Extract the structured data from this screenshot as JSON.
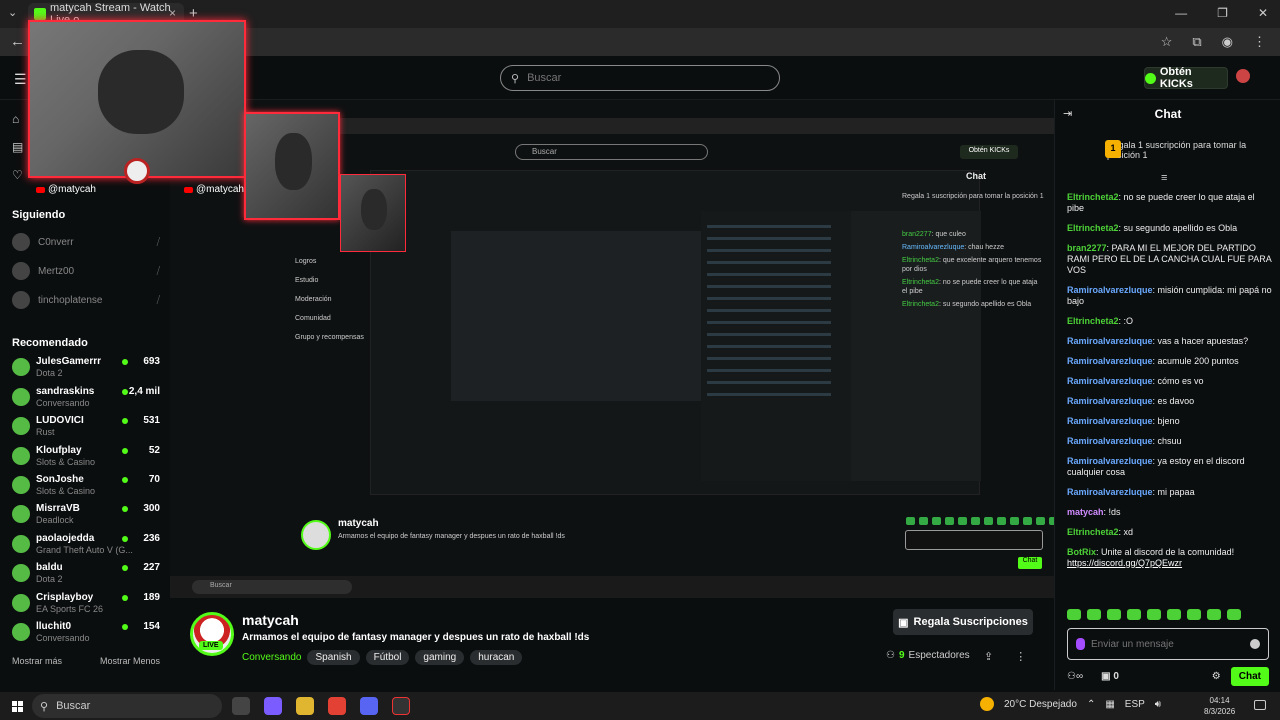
{
  "browser": {
    "tab_title": "matycah Stream - Watch Live o",
    "tab_close": "×",
    "new_tab": "+"
  },
  "header": {
    "search_placeholder": "Buscar",
    "kicks_label": "Obtén KICKs"
  },
  "webcam": {
    "handle": "@matycah"
  },
  "sidebar": {
    "following_title": "Siguiendo",
    "following": [
      {
        "name": "C0nverr"
      },
      {
        "name": "Mertz00"
      },
      {
        "name": "tinchoplatense"
      }
    ],
    "recommended_title": "Recomendado",
    "recommended": [
      {
        "name": "JulesGamerrr",
        "category": "Dota 2",
        "viewers": "693"
      },
      {
        "name": "sandraskins",
        "category": "Conversando",
        "viewers": "2,4 mil"
      },
      {
        "name": "LUDOVICI",
        "category": "Rust",
        "viewers": "531"
      },
      {
        "name": "Kloufplay",
        "category": "Slots & Casino",
        "viewers": "52"
      },
      {
        "name": "SonJoshe",
        "category": "Slots & Casino",
        "viewers": "70"
      },
      {
        "name": "MisrraVB",
        "category": "Deadlock",
        "viewers": "300"
      },
      {
        "name": "paolaojedda",
        "category": "Grand Theft Auto V (G...",
        "viewers": "236"
      },
      {
        "name": "baldu",
        "category": "Dota 2",
        "viewers": "227"
      },
      {
        "name": "Crisplayboy",
        "category": "EA Sports FC 26",
        "viewers": "189"
      },
      {
        "name": "lluchit0",
        "category": "Conversando",
        "viewers": "154"
      }
    ],
    "show_more": "Mostrar más",
    "show_less": "Mostrar Menos"
  },
  "stream_preview": {
    "search": "Buscar",
    "kicks": "Obtén KICKs",
    "chat_title": "Chat",
    "gift": "Regala 1 suscripción para tomar la posición 1",
    "nav": [
      "Logros",
      "Estudio",
      "Moderación",
      "Comunidad",
      "Grupo y recompensas"
    ],
    "messages": [
      {
        "user": "bran2277",
        "text": "que culeo"
      },
      {
        "user": "Ramiroalvarezluque",
        "text": "chau hezze"
      },
      {
        "user": "Eltrincheta2",
        "text": "que excelente arquero tenemos por dios"
      },
      {
        "user": "Eltrincheta2",
        "text": "no se puede creer lo que ataja el pibe"
      },
      {
        "user": "Eltrincheta2",
        "text": "su segundo apellido es Obla"
      }
    ],
    "info_title": "Armamos el equipo de fantasy manager y despues un rato de haxball !ds",
    "search_taskbar": "Buscar"
  },
  "channel": {
    "name": "matycah",
    "live": "LIVE",
    "title": "Armamos el equipo de fantasy manager y despues un rato de haxball !ds",
    "category": "Conversando",
    "tags": [
      "Spanish",
      "Fútbol",
      "gaming",
      "huracan"
    ],
    "subs_button": "Regala Suscripciones",
    "viewers_count": "9",
    "viewers_label": "Espectadores"
  },
  "chat": {
    "title": "Chat",
    "gift_badge": "1",
    "gift_text": "Regala 1 suscripción para tomar la posición 1",
    "messages": [
      {
        "user": "Eltrincheta2",
        "text": "no se puede creer lo que ataja el pibe",
        "color": "#4cd137"
      },
      {
        "user": "Eltrincheta2",
        "text": "su segundo apellido es Obla",
        "color": "#4cd137"
      },
      {
        "user": "bran2277",
        "text": "PARA MI EL MEJOR DEL PARTIDO RAMI PERO EL DE LA CANCHA CUAL FUE PARA VOS",
        "color": "#4cd137"
      },
      {
        "user": "Ramiroalvarezluque",
        "text": "misión cumplida: mi papá no bajo",
        "color": "#6aa9ff"
      },
      {
        "user": "Eltrincheta2",
        "text": ":O",
        "color": "#4cd137"
      },
      {
        "user": "Ramiroalvarezluque",
        "text": "vas a hacer apuestas?",
        "color": "#6aa9ff"
      },
      {
        "user": "Ramiroalvarezluque",
        "text": "acumule 200 puntos",
        "color": "#6aa9ff"
      },
      {
        "user": "Ramiroalvarezluque",
        "text": "cómo es vo",
        "color": "#6aa9ff"
      },
      {
        "user": "Ramiroalvarezluque",
        "text": "es davoo",
        "color": "#6aa9ff"
      },
      {
        "user": "Ramiroalvarezluque",
        "text": "bjeno",
        "color": "#6aa9ff"
      },
      {
        "user": "Ramiroalvarezluque",
        "text": "chsuu",
        "color": "#6aa9ff"
      },
      {
        "user": "Ramiroalvarezluque",
        "text": "ya estoy en el discord cualquier cosa",
        "color": "#6aa9ff"
      },
      {
        "user": "Ramiroalvarezluque",
        "text": "mi papaa",
        "color": "#6aa9ff"
      },
      {
        "user": "matycah",
        "text": "!ds",
        "color": "#d08cff"
      },
      {
        "user": "Eltrincheta2",
        "text": "xd",
        "color": "#4cd137"
      },
      {
        "user": "BotRix",
        "text": "Unite al discord de la comunidad!",
        "color": "#4cd137",
        "link": "https://discord.gg/Q7pQEwzr"
      }
    ],
    "input_placeholder": "Enviar un mensaje",
    "points": "0",
    "send_label": "Chat"
  },
  "taskbar": {
    "search": "Buscar",
    "weather": "20°C Despejado",
    "lang": "ESP",
    "time": "04:14",
    "date": "8/3/2026"
  }
}
